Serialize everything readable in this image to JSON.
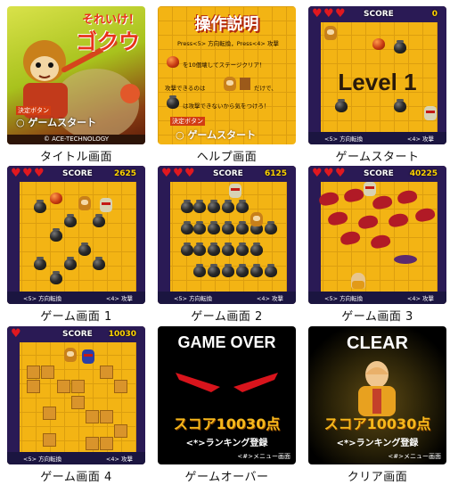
{
  "captions": {
    "title": "タイトル画面",
    "help": "ヘルプ画面",
    "start": "ゲームスタート",
    "game1": "ゲーム画面 1",
    "game2": "ゲーム画面 2",
    "game3": "ゲーム画面 3",
    "game4": "ゲーム画面 4",
    "gameover": "ゲームオーバー",
    "clear": "クリア画面"
  },
  "title_screen": {
    "logo_line1": "それいけ！",
    "logo_line2": "ゴクウ",
    "decide_label": "決定ボタン",
    "start_label": "ゲームスタート",
    "copyright": "© ACE-TECHNOLOGY"
  },
  "help_screen": {
    "heading": "操作説明",
    "line1": "Press<5> 方向転換，Press<4> 攻撃",
    "line2": "を10個壊してステージクリア！",
    "line3": "攻撃できるのは",
    "line3b": "だけで、",
    "line4": "は攻撃できないから気をつけろ！",
    "decide_label": "決定ボタン",
    "start_label": "ゲームスタート"
  },
  "hud": {
    "score_label": "SCORE",
    "left_ctrl": "<5> 方向転換",
    "right_ctrl": "<4> 攻撃"
  },
  "screens": {
    "start": {
      "score": "0",
      "overlay": "Level 1"
    },
    "game1": {
      "score": "2625"
    },
    "game2": {
      "score": "6125"
    },
    "game3": {
      "score": "40225"
    },
    "game4": {
      "score": "10030"
    }
  },
  "gameover_screen": {
    "heading": "GAME OVER",
    "score_text": "スコア10030点",
    "ranking": "<*>ランキング登録",
    "menu": "<#>メニュー画面"
  },
  "clear_screen": {
    "heading": "CLEAR",
    "score_text": "スコア10030点",
    "ranking": "<*>ランキング登録",
    "menu": "<#>メニュー画面"
  },
  "colors": {
    "board": "#f3b414",
    "score_value": "#ffd400",
    "heart": "#e0181f",
    "fire": "#b11a26"
  }
}
